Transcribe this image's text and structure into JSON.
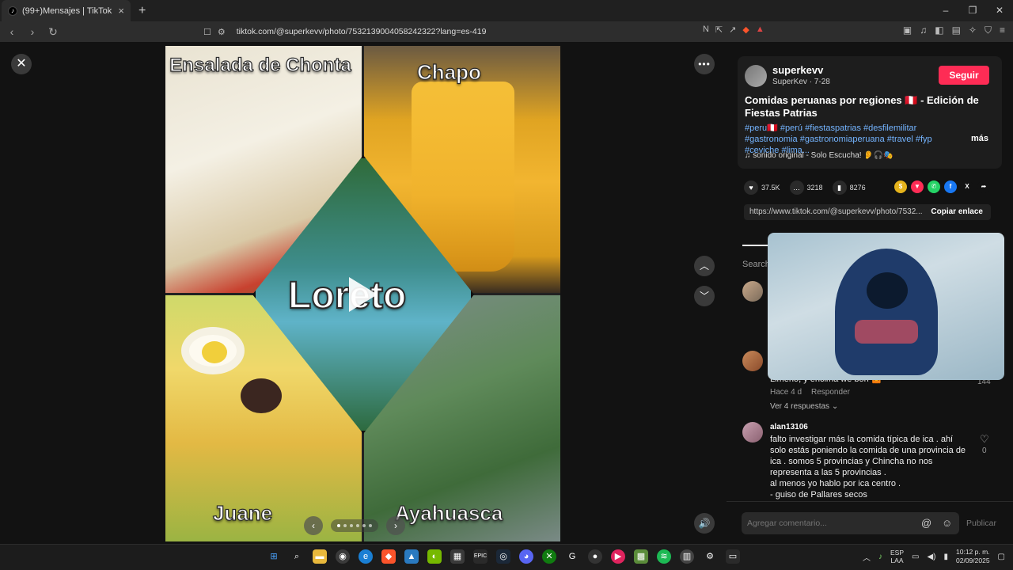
{
  "browser": {
    "tab_title": "(99+)Mensajes | TikTok",
    "tab_close": "×",
    "new_tab": "+",
    "url": "tiktok.com/@superkevv/photo/7532139004058242322?lang=es-419",
    "win_min": "–",
    "win_max": "❐",
    "win_close": "✕",
    "back": "‹",
    "forward": "›",
    "reload": "↻"
  },
  "viewer": {
    "close": "✕",
    "more": "•••",
    "up": "︿",
    "down": "﹀",
    "volume": "🔊",
    "labels": {
      "top_left": "Ensalada de Chonta",
      "top_right": "Chapo",
      "center": "Loreto",
      "bottom_left": "Juane",
      "bottom_right": "Ayahuasca"
    },
    "carousel_prev": "‹",
    "carousel_next": "›"
  },
  "post": {
    "username": "superkevv",
    "subline": "SuperKev · 7-28",
    "follow_label": "Seguir",
    "title": "Comidas peruanas por regiones 🇵🇪 - Edición de Fiestas Patrias",
    "tags": "#peru🇵🇪 #perú #fiestaspatrias #desfilemilitar #gastronomia #gastronomiaperuana #travel #fyp #ceviche #lima...",
    "more": "más",
    "sound": "♫ sonido original - Solo Escucha! 👂🎧🎭",
    "likes": "37.5K",
    "comments": "3218",
    "saves": "8276",
    "link": "https://www.tiktok.com/@superkevv/photo/7532...",
    "copy_link": "Copiar enlace",
    "search_label": "Search"
  },
  "comments": {
    "c2_text": "Limeño, y encima we bon 🤷",
    "c2_time": "Hace 4 d",
    "c2_reply": "Responder",
    "c2_likes": "144",
    "c2_replies": "Ver 4 respuestas ⌄",
    "c3_name": "alan13106",
    "c3_text_1": "falto investigar más la comida típica de ica . ahí",
    "c3_text_2": "solo estás poniendo la comida de una provincia de",
    "c3_text_3": "ica . somos 5 provincias y Chincha no nos",
    "c3_text_4": "representa a las 5 provincias .",
    "c3_text_5": "al menos yo hablo por ica centro .",
    "c3_text_6": "- guiso de Pallares secos",
    "c3_likes": "0",
    "heart": "♡"
  },
  "composer": {
    "placeholder": "Agregar comentario...",
    "at_icon": "@",
    "emoji_icon": "☺",
    "publish": "Publicar"
  },
  "taskbar": {
    "lang_1": "ESP",
    "lang_2": "LAA",
    "time": "10:12 p. m.",
    "date": "02/09/2025"
  },
  "colors": {
    "accent": "#fe2c55",
    "link": "#74b4ff"
  }
}
